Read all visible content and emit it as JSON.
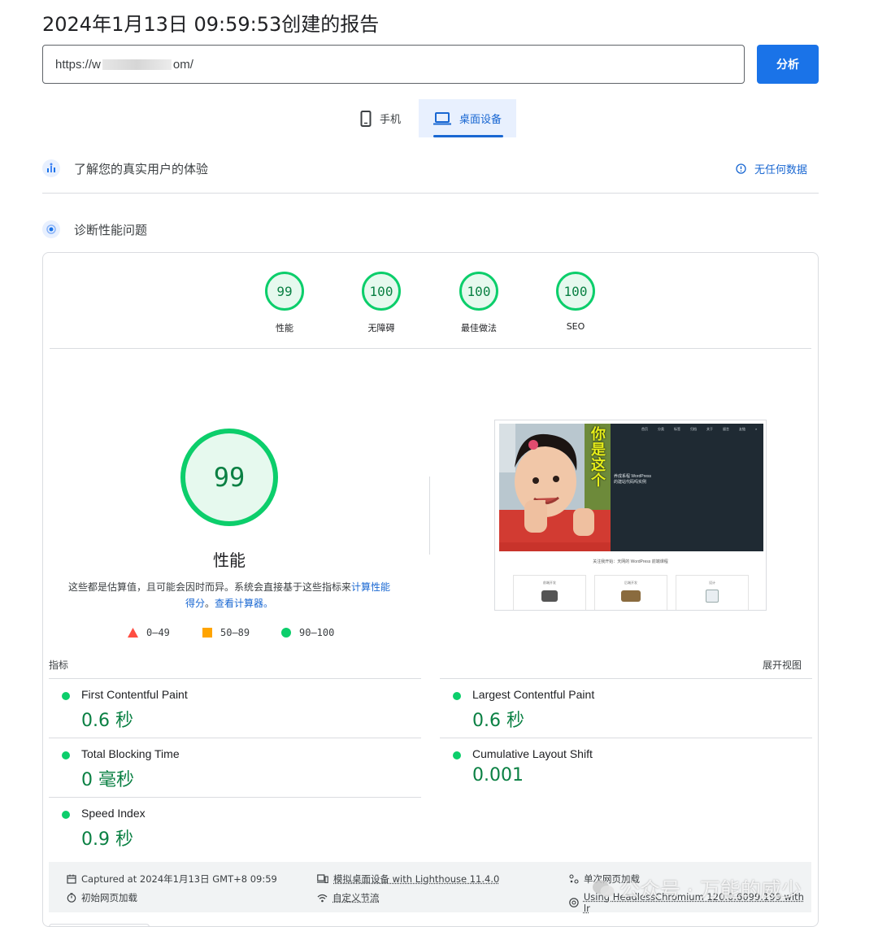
{
  "header": {
    "title": "2024年1月13日 09:59:53创建的报告",
    "url_prefix": "https://w",
    "url_suffix": "om/",
    "analyze_label": "分析"
  },
  "tabs": {
    "mobile": "手机",
    "desktop": "桌面设备"
  },
  "field_section": {
    "label": "了解您的真实用户的体验",
    "no_data": "无任何数据"
  },
  "lab_section": {
    "label": "诊断性能问题"
  },
  "scores": [
    {
      "score": "99",
      "label": "性能"
    },
    {
      "score": "100",
      "label": "无障碍"
    },
    {
      "score": "100",
      "label": "最佳做法"
    },
    {
      "score": "100",
      "label": "SEO"
    }
  ],
  "performance": {
    "score": "99",
    "title": "性能",
    "desc_text": "这些都是估算值，且可能会因时而异。系统会直接基于这些指标来",
    "desc_link1": "计算性能得分",
    "desc_sep": "。",
    "desc_link2": "查看计算器。"
  },
  "legend": {
    "fail": "0–49",
    "average": "50–89",
    "pass": "90–100"
  },
  "metrics_header": {
    "title": "指标",
    "expand": "展开视图"
  },
  "metrics": [
    {
      "name": "First Contentful Paint",
      "value": "0.6 秒"
    },
    {
      "name": "Largest Contentful Paint",
      "value": "0.6 秒"
    },
    {
      "name": "Total Blocking Time",
      "value": "0 毫秒"
    },
    {
      "name": "Cumulative Layout Shift",
      "value": "0.001"
    },
    {
      "name": "Speed Index",
      "value": "0.9 秒"
    }
  ],
  "footer": {
    "captured": "Captured at 2024年1月13日 GMT+8 09:59",
    "initial_load": "初始网页加载",
    "emulated": "模拟桌面设备 with Lighthouse 11.4.0",
    "throttling": "自定义节流",
    "single_load": "单次网页加载",
    "browser": "Using HeadlessChromium 120.0.6099.199 with lr"
  },
  "screenshot_text": {
    "nav": [
      "首页",
      "分类",
      "标签",
      "归档",
      "关于",
      "留言",
      "友链",
      "⌕"
    ],
    "hero_line1": "养成系程 WordPress",
    "hero_line2": "的建站代码吗实例",
    "bottom_line": "关注我开始：天网的 WordPress 前端课程",
    "vertical": "你是这个",
    "card1": "前端开发",
    "card2": "后端开发",
    "card3": "设计"
  },
  "watermark": "公众号 · 万能的威少",
  "colors": {
    "pass": "#0cce6b",
    "pass_text": "#0a8043",
    "average": "#ffa400",
    "fail": "#ff4e42",
    "accent": "#1a73e8"
  }
}
